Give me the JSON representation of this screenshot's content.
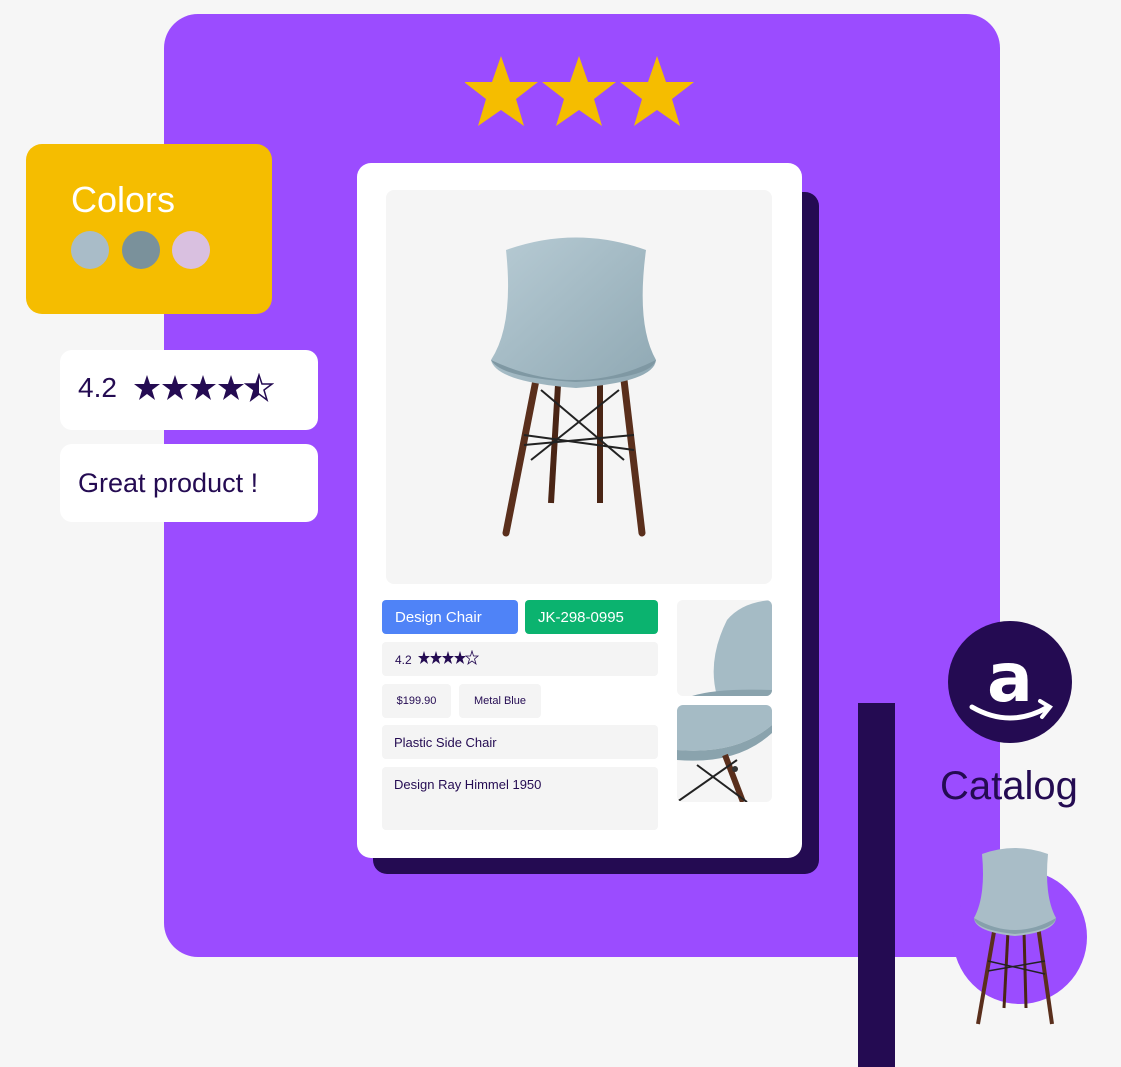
{
  "colors_card": {
    "title": "Colors",
    "swatches": [
      "#a9bcc8",
      "#7a919b",
      "#d9c0e0"
    ]
  },
  "rating": {
    "value": "4.2",
    "stars": 4.5
  },
  "review": {
    "text": "Great product !"
  },
  "top_stars": 3,
  "product": {
    "name": "Design Chair",
    "code": "JK-298-0995",
    "rating_value": "4.2",
    "price": "$199.90",
    "color": "Metal Blue",
    "type": "Plastic Side Chair",
    "description": "Design Ray Himmel 1950"
  },
  "catalog": {
    "label": "Catalog",
    "icon": "amazon-icon"
  },
  "palette": {
    "purple": "#9b4cff",
    "dark": "#240b52",
    "yellow": "#f5bd00",
    "blue": "#4f83f7",
    "green": "#0bb36f"
  }
}
